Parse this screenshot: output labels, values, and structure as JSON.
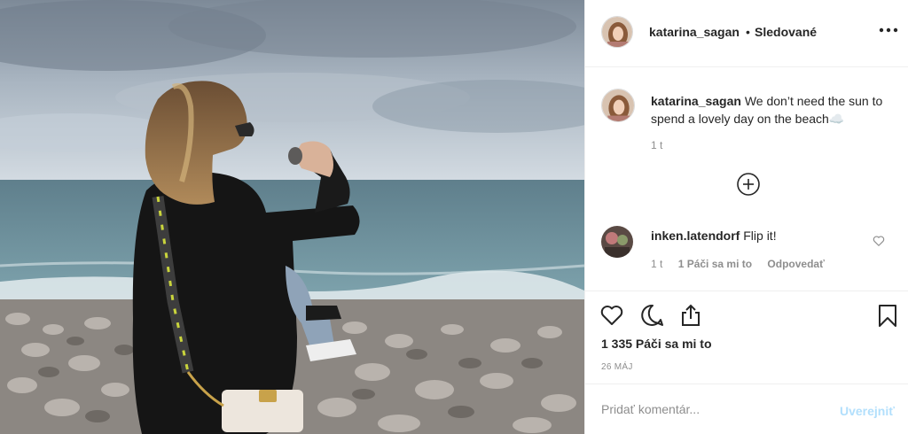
{
  "post": {
    "image_alt": "Woman with ponytail sitting on a pebble beach looking at the sea",
    "strap_text": "MARC JACOBS"
  },
  "header": {
    "username": "katarina_sagan",
    "separator": "•",
    "follow_status": "Sledované",
    "more_icon": "more-horizontal-icon"
  },
  "caption": {
    "username": "katarina_sagan",
    "text": "We don’t need the sun to spend a lovely day on the beach☁️",
    "time": "1 t"
  },
  "load_more_icon": "plus-circle-icon",
  "comments": [
    {
      "username": "inken.latendorf",
      "text": "Flip it!",
      "time": "1 t",
      "likes": "1 Páči sa mi to",
      "reply": "Odpovedať"
    }
  ],
  "actions": {
    "icons": [
      "heart-icon",
      "comment-icon",
      "share-icon",
      "bookmark-icon"
    ],
    "likes_text": "1 335 Páči sa mi to",
    "date": "26 MÁJ"
  },
  "add_comment": {
    "placeholder": "Pridať komentár...",
    "post_label": "Uverejniť"
  },
  "colors": {
    "link_blue_disabled": "#b2dffc",
    "secondary_text": "#8e8e8e",
    "border": "#efefef"
  }
}
